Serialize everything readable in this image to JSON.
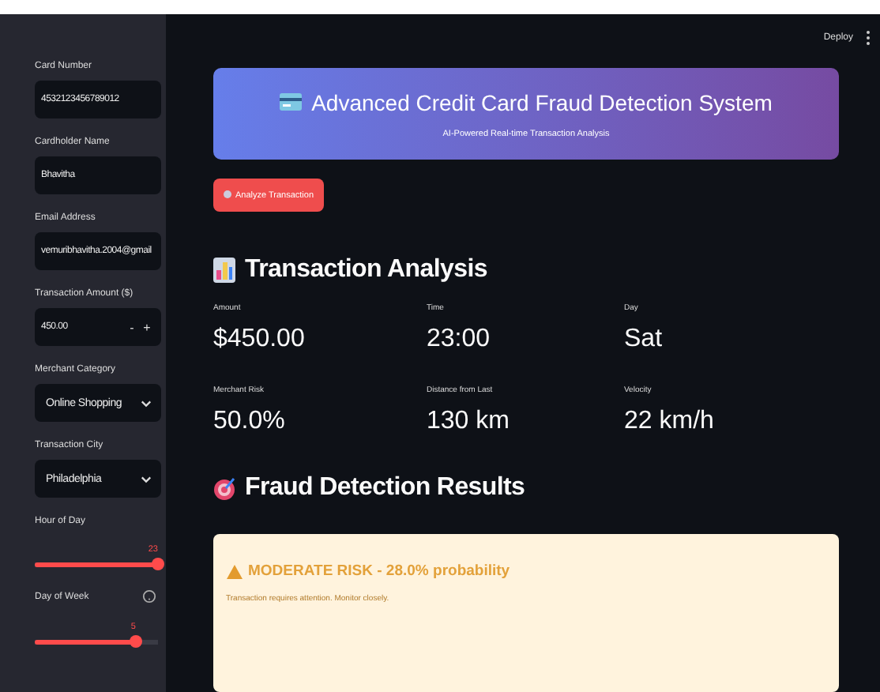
{
  "header": {
    "deploy": "Deploy"
  },
  "sidebar": {
    "fields": [
      {
        "kind": "text",
        "label": "Card Number",
        "value": "4532123456789012"
      },
      {
        "kind": "text",
        "label": "Cardholder Name",
        "value": "Bhavitha"
      },
      {
        "kind": "text",
        "label": "Email Address",
        "value": "vemuribhavitha.2004@gmail"
      },
      {
        "kind": "number",
        "label": "Transaction Amount ($)",
        "value": "450.00",
        "minus": "-",
        "plus": "+"
      },
      {
        "kind": "select",
        "label": "Merchant Category",
        "value": "Online Shopping"
      },
      {
        "kind": "select",
        "label": "Transaction City",
        "value": "Philadelphia"
      },
      {
        "kind": "slider",
        "label": "Hour of Day",
        "value": "23",
        "level": 1,
        "help": false
      },
      {
        "kind": "slider",
        "label": "Day of Week",
        "value": "5",
        "level": 0.82,
        "help": true
      }
    ]
  },
  "banner": {
    "title": "Advanced Credit Card Fraud Detection System",
    "subtitle": "AI-Powered Real-time Transaction Analysis"
  },
  "analyze_button": "Analyze Transaction",
  "analysis": {
    "heading": "Transaction Analysis",
    "metrics": [
      {
        "label": "Amount",
        "value": "$450.00"
      },
      {
        "label": "Time",
        "value": "23:00"
      },
      {
        "label": "Day",
        "value": "Sat"
      },
      {
        "label": "Merchant Risk",
        "value": "50.0%"
      },
      {
        "label": "Distance from Last",
        "value": "130 km"
      },
      {
        "label": "Velocity",
        "value": "22 km/h"
      }
    ]
  },
  "results": {
    "heading": "Fraud Detection Results",
    "alert": {
      "title": "MODERATE RISK - 28.0% probability",
      "message": "Transaction requires attention. Monitor closely."
    }
  }
}
